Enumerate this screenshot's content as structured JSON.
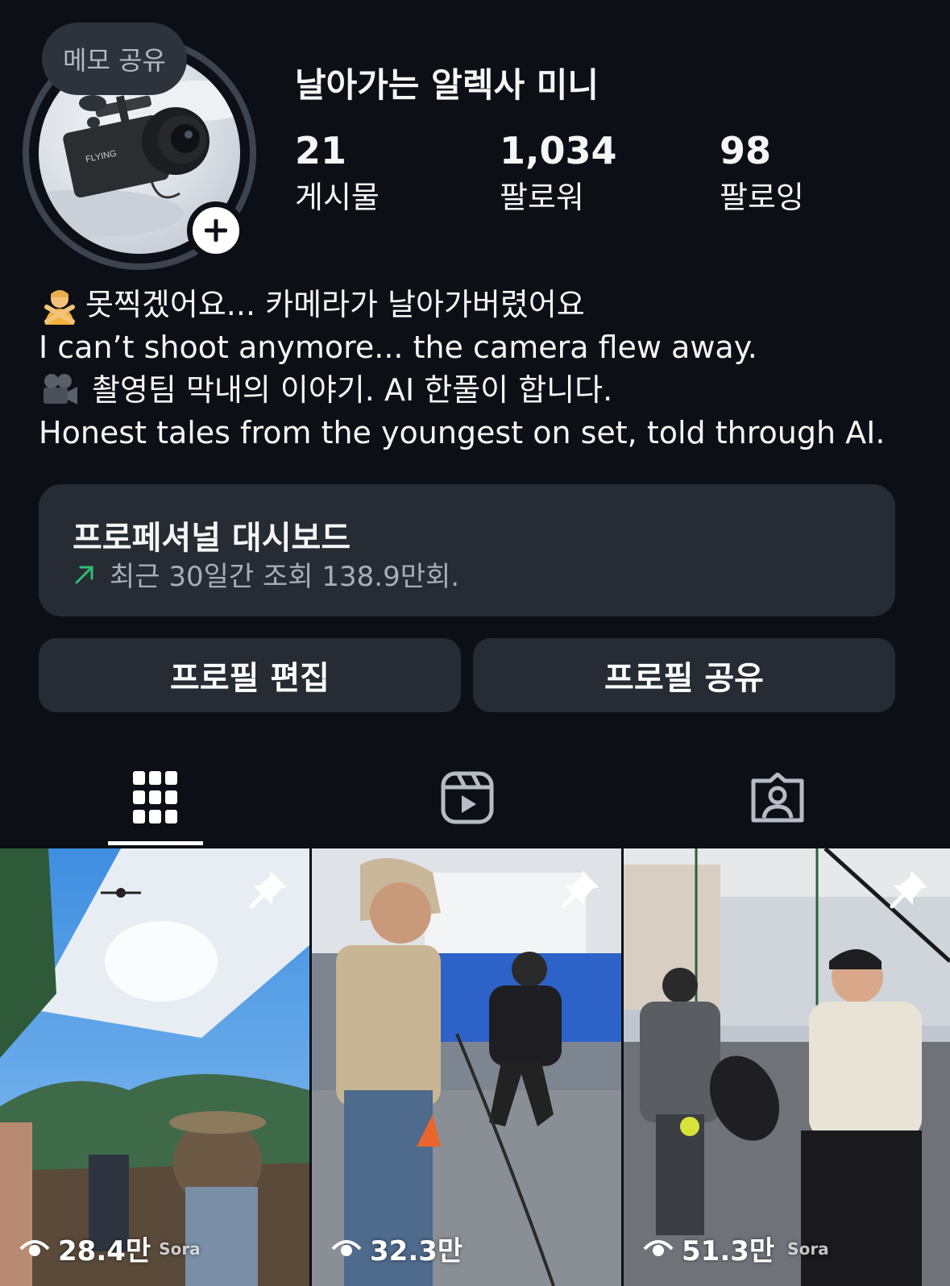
{
  "profile": {
    "memo_label": "메모 공유",
    "username": "날아가는 알렉사 미니",
    "stats": [
      {
        "value": "21",
        "label": "게시물"
      },
      {
        "value": "1,034",
        "label": "팔로워"
      },
      {
        "value": "98",
        "label": "팔로잉"
      }
    ],
    "camera_brand": "FLYING"
  },
  "bio": {
    "line1": "못찍겠어요... 카메라가 날아가버렸어요",
    "line2": "I can’t shoot anymore... the camera flew away.",
    "line3": "촬영팀 막내의 이야기. AI 한풀이 합니다.",
    "line4": "Honest tales from the youngest on set, told through AI."
  },
  "dashboard": {
    "title": "프로페셔널 대시보드",
    "subtitle": "최근 30일간 조회 138.9만회.",
    "trend_color": "#2fbf71"
  },
  "buttons": {
    "edit_profile": "프로필 편집",
    "share_profile": "프로필 공유"
  },
  "tabs": {
    "icons": [
      "grid-icon",
      "reels-icon",
      "tagged-icon"
    ],
    "active": 0
  },
  "posts": [
    {
      "views": "28.4만",
      "pinned": true,
      "watermark": "Sora"
    },
    {
      "views": "32.3만",
      "pinned": true,
      "watermark": ""
    },
    {
      "views": "51.3만",
      "pinned": true,
      "watermark": "Sora"
    }
  ]
}
